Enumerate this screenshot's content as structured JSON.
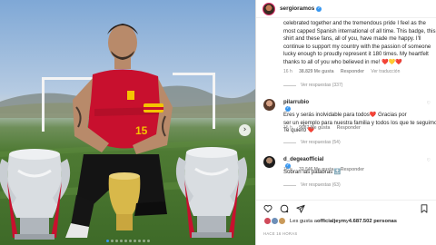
{
  "photo": {
    "jersey_number": "15",
    "next_icon": "chevron-right-icon"
  },
  "post": {
    "username": "sergioramos",
    "caption_lines": [
      "celebrated together and the tremendous pride I feel as the",
      "most capped Spanish international of all time. This badge, this",
      "shirt and these fans, all of you, have made me happy. I'll",
      "continue to support my country with the passion of someone",
      "lucky enough to proudly represent it 180 times. My heartfelt",
      "thanks to all of you who believed in me! ❤️💛❤️"
    ],
    "caption_meta": {
      "time": "16 h",
      "likes": "38.829 Me gusta",
      "reply": "Responder",
      "translate": "Ver traducción"
    },
    "caption_replies": "Ver respuestas (337)"
  },
  "comments": [
    {
      "username": "pilarrubio",
      "lines": [
        " Eres y serás inolvidable para todos❤️ Gracias por",
        "ser un ejemplo para nuestra familia y todos los que te seguimos.",
        "Te quiero ❤️"
      ],
      "time": "15 h",
      "likes": "9087 Me gusta",
      "reply": "Responder",
      "replies": "Ver respuestas (54)"
    },
    {
      "username": "d_degeaofficial",
      "lines": [
        " Sobran las palabras 🔝"
      ],
      "time": "16 h",
      "likes": "32.546 Me gusta",
      "reply": "Responder",
      "replies": "Ver respuestas (63)"
    }
  ],
  "likes_summary": {
    "prefix": "Les gusta a ",
    "user": "officialjeym",
    "middle": " y ",
    "count": "4.687.502 personas"
  },
  "timestamp": "HACE 16 HORAS",
  "colors": {
    "accent": "#3897f0",
    "secondary_text": "#8e8e8e",
    "primary_text": "#262626",
    "jersey": "#c8102e"
  }
}
